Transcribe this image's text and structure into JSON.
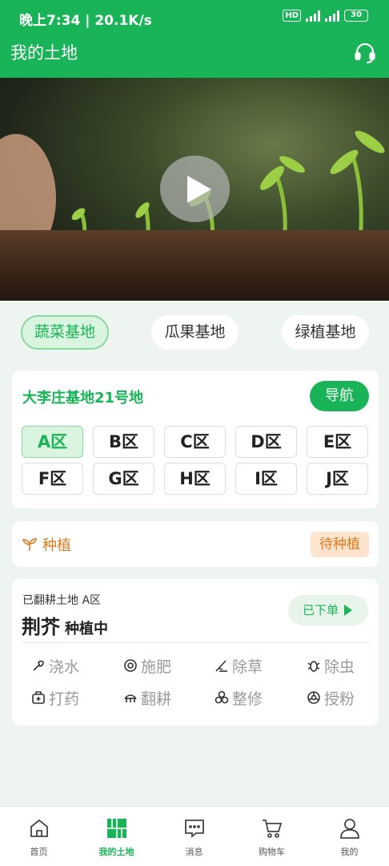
{
  "status_bar": {
    "time": "晚上7:34 | 20.1K/s",
    "hd": "HD",
    "battery": "30"
  },
  "header": {
    "title": "我的土地",
    "support_icon": "headset-icon"
  },
  "video": {
    "play_icon": "play-icon"
  },
  "categories": [
    {
      "label": "蔬菜基地",
      "active": true
    },
    {
      "label": "瓜果基地",
      "active": false
    },
    {
      "label": "绿植基地",
      "active": false
    }
  ],
  "base": {
    "name": "大李庄基地21号地",
    "nav_label": "导航",
    "zones": [
      "A区",
      "B区",
      "C区",
      "D区",
      "E区",
      "F区",
      "G区",
      "H区",
      "I区",
      "J区"
    ],
    "selected_zone": "A区"
  },
  "planting": {
    "label": "种植",
    "icon": "sprout-icon",
    "status": "待种植"
  },
  "plot": {
    "subtitle": "已翻耕土地 A区",
    "crop": "荆芥",
    "state": "种植中",
    "ordered_label": "已下单",
    "actions": [
      "浇水",
      "施肥",
      "除草",
      "除虫",
      "打药",
      "翻耕",
      "整修",
      "授粉"
    ]
  },
  "tabs": [
    {
      "label": "首页",
      "icon": "home-icon"
    },
    {
      "label": "我的土地",
      "icon": "land-icon",
      "active": true
    },
    {
      "label": "消息",
      "icon": "message-icon"
    },
    {
      "label": "购物车",
      "icon": "cart-icon"
    },
    {
      "label": "我的",
      "icon": "user-icon"
    }
  ],
  "colors": {
    "primary": "#19b457",
    "accent_orange": "#e07a1f",
    "background": "#eef4f0"
  }
}
